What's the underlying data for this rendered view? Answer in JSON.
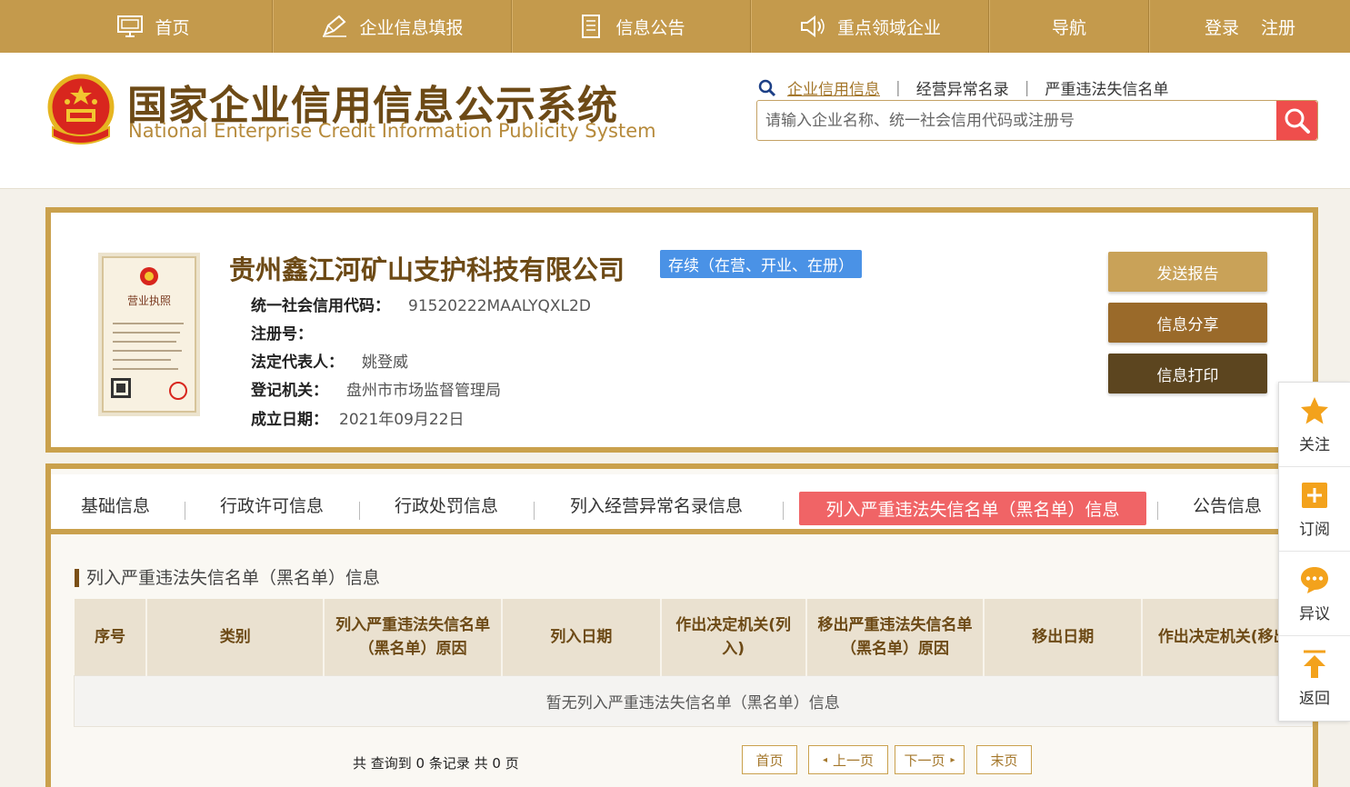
{
  "nav": {
    "home": "首页",
    "fill": "企业信息填报",
    "notice": "信息公告",
    "key_field": "重点领域企业",
    "guide": "导航",
    "login": "登录",
    "register": "注册"
  },
  "header": {
    "title": "国家企业信用信息公示系统",
    "subtitle": "National Enterprise Credit Information Publicity System",
    "search_tabs": [
      "企业信用信息",
      "经营异常名录",
      "严重违法失信名单"
    ],
    "search_placeholder": "请输入企业名称、统一社会信用代码或注册号"
  },
  "company": {
    "name": "贵州鑫江河矿山支护科技有限公司",
    "status": "存续（在营、开业、在册）",
    "credit_code_label": "统一社会信用代码：",
    "credit_code": "91520222MAALYQXL2D",
    "reg_no_label": "注册号：",
    "reg_no": "",
    "legal_rep_label": "法定代表人：",
    "legal_rep": "姚登威",
    "authority_label": "登记机关：",
    "authority": "盘州市市场监督管理局",
    "founded_label": "成立日期：",
    "founded": "2021年09月22日",
    "license_title": "营业执照",
    "actions": {
      "send": "发送报告",
      "share": "信息分享",
      "print": "信息打印"
    }
  },
  "tabs": [
    "基础信息",
    "行政许可信息",
    "行政处罚信息",
    "列入经营异常名录信息",
    "列入严重违法失信名单（黑名单）信息",
    "公告信息"
  ],
  "section": {
    "title": "列入严重违法失信名单（黑名单）信息",
    "columns": [
      "序号",
      "类别",
      "列入严重违法失信名单（黑名单）原因",
      "列入日期",
      "作出决定机关(列入)",
      "移出严重违法失信名单（黑名单）原因",
      "移出日期",
      "作出决定机关(移出)"
    ],
    "empty": "暂无列入严重违法失信名单（黑名单）信息"
  },
  "pager": {
    "info": "共 查询到 0 条记录 共 0 页",
    "first": "首页",
    "prev": "上一页",
    "next": "下一页",
    "last": "末页"
  },
  "float": {
    "follow": "关注",
    "subscribe": "订阅",
    "dispute": "异议",
    "back": "返回"
  },
  "colors": {
    "gold": "#c49a4c",
    "brown": "#6d4a16",
    "status_blue": "#4a92e6",
    "active_tab": "#f06466",
    "search_btn": "#ef4e4c"
  }
}
